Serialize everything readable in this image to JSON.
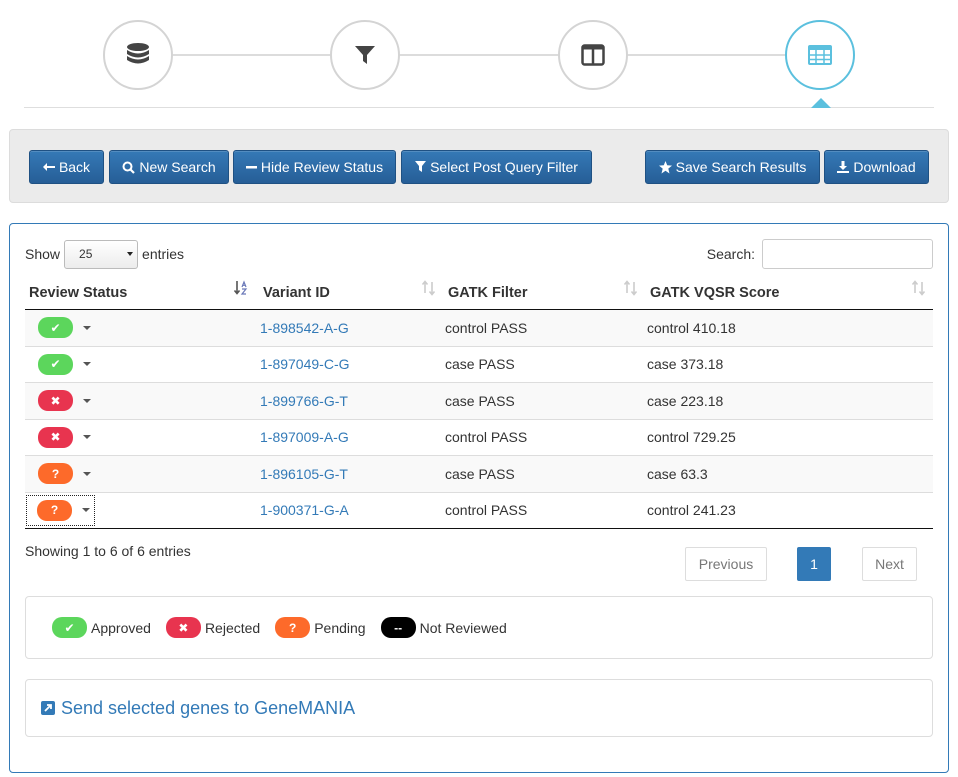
{
  "wizard": {
    "steps": [
      {
        "icon": "database-icon",
        "active": false
      },
      {
        "icon": "filter-icon",
        "active": false
      },
      {
        "icon": "columns-icon",
        "active": false
      },
      {
        "icon": "table-icon",
        "active": true
      }
    ],
    "active_color": "#5bc0de"
  },
  "toolbar": {
    "back_label": "Back",
    "new_search_label": "New Search",
    "hide_review_label": "Hide Review Status",
    "post_query_label": "Select Post Query Filter",
    "save_label": "Save Search Results",
    "download_label": "Download"
  },
  "table_controls": {
    "show_label": "Show",
    "page_size": "25",
    "entries_label": "entries",
    "search_label": "Search:",
    "search_value": ""
  },
  "table": {
    "columns": [
      "Review Status",
      "Variant ID",
      "GATK Filter",
      "GATK VQSR Score"
    ],
    "rows": [
      {
        "status": "approved",
        "status_glyph": "✔",
        "variant": "1-898542-A-G",
        "filter": "control PASS",
        "score": "control 410.18"
      },
      {
        "status": "approved",
        "status_glyph": "✔",
        "variant": "1-897049-C-G",
        "filter": "case PASS",
        "score": "case 373.18"
      },
      {
        "status": "rejected",
        "status_glyph": "✖",
        "variant": "1-899766-G-T",
        "filter": "case PASS",
        "score": "case 223.18"
      },
      {
        "status": "rejected",
        "status_glyph": "✖",
        "variant": "1-897009-A-G",
        "filter": "control PASS",
        "score": "control 729.25"
      },
      {
        "status": "pending",
        "status_glyph": "?",
        "variant": "1-896105-G-T",
        "filter": "case PASS",
        "score": "case 63.3"
      },
      {
        "status": "pending",
        "status_glyph": "?",
        "variant": "1-900371-G-A",
        "filter": "control PASS",
        "score": "control 241.23"
      }
    ]
  },
  "info_text": "Showing 1 to 6 of 6 entries",
  "pagination": {
    "previous_label": "Previous",
    "current_page": "1",
    "next_label": "Next"
  },
  "legend": {
    "items": [
      {
        "class": "approved",
        "glyph": "✔",
        "label": "Approved"
      },
      {
        "class": "rejected",
        "glyph": "✖",
        "label": "Rejected"
      },
      {
        "class": "pending",
        "glyph": "?",
        "label": "Pending"
      },
      {
        "class": "none",
        "glyph": "--",
        "label": "Not Reviewed"
      }
    ]
  },
  "genemania": {
    "link_label": "Send selected genes to GeneMANIA"
  },
  "colors": {
    "primary": "#337ab7",
    "approved": "#5cd65c",
    "rejected": "#e8344f",
    "pending": "#fd6a2a",
    "not_reviewed": "#000000"
  }
}
